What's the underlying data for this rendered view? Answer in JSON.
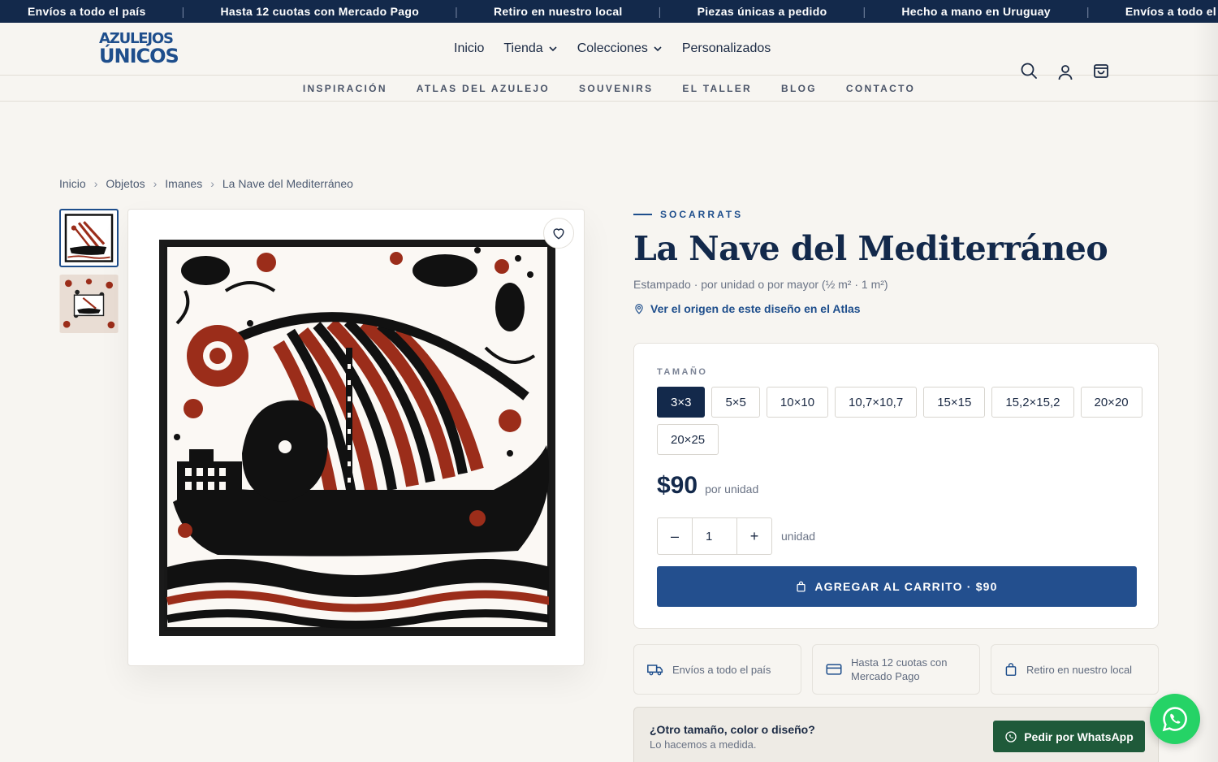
{
  "announcement": {
    "items": [
      "Envíos a todo el país",
      "Hasta 12 cuotas con Mercado Pago",
      "Retiro en nuestro local",
      "Piezas únicas a pedido",
      "Hecho a mano en Uruguay",
      "Envíos a todo el"
    ]
  },
  "brand": {
    "logo_line1": "AZULEJOS",
    "logo_line2": "ÚNICOS"
  },
  "nav": {
    "items": [
      {
        "label": "Inicio"
      },
      {
        "label": "Tienda",
        "dropdown": true
      },
      {
        "label": "Colecciones",
        "dropdown": true
      },
      {
        "label": "Personalizados"
      }
    ],
    "icons": [
      "search-icon",
      "user-icon",
      "cart-icon"
    ]
  },
  "subnav": {
    "items": [
      "INSPIRACIÓN",
      "ATLAS DEL AZULEJO",
      "SOUVENIRS",
      "EL TALLER",
      "BLOG",
      "CONTACTO"
    ]
  },
  "breadcrumb": [
    "Inicio",
    "Objetos",
    "Imanes",
    "La Nave del Mediterráneo"
  ],
  "product": {
    "eyebrow": "SOCARRATS",
    "title": "La Nave del Mediterráneo",
    "subtitle": "Estampado · por unidad o por mayor (½ m² · 1 m²)",
    "atlas_link": "Ver el origen de este diseño en el Atlas",
    "size_label": "TAMAÑO",
    "sizes": [
      "3×3",
      "5×5",
      "10×10",
      "10,7×10,7",
      "15×15",
      "15,2×15,2",
      "20×20",
      "20×25"
    ],
    "selected_size": "3×3",
    "price": "$90",
    "price_unit": "por unidad",
    "quantity": "1",
    "quantity_minus": "–",
    "quantity_plus": "+",
    "quantity_unit": "unidad",
    "add_to_cart": "AGREGAR AL CARRITO ·  $90"
  },
  "features": [
    {
      "icon": "truck-icon",
      "label": "Envíos a todo el país"
    },
    {
      "icon": "card-icon",
      "label": "Hasta 12 cuotas con Mercado Pago"
    },
    {
      "icon": "bag-icon",
      "label": "Retiro en nuestro local"
    }
  ],
  "custom": {
    "question": "¿Otro tamaño, color o diseño?",
    "subtext": "Lo hacemos a medida.",
    "button": "Pedir por WhatsApp"
  },
  "colors": {
    "navy": "#13294b",
    "accent": "#234f8e",
    "whatsapp": "#25d366",
    "whatsapp_dark": "#1f5a3a",
    "tile_red": "#9b2d1a"
  }
}
